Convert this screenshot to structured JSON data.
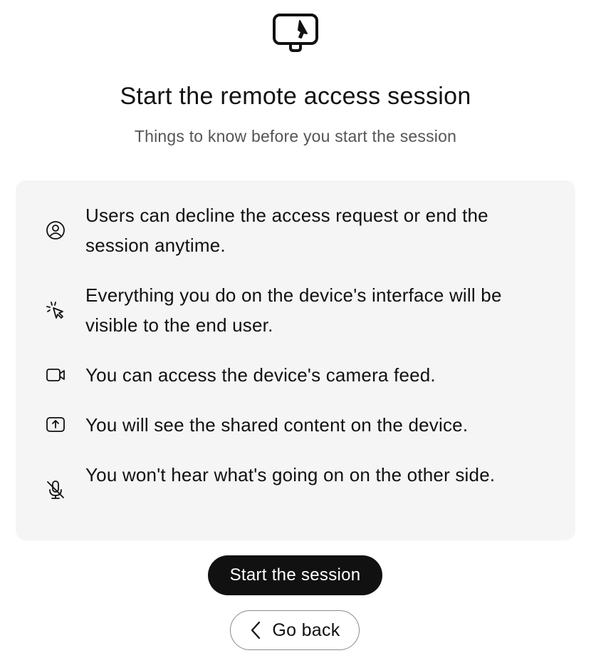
{
  "header": {
    "icon": "monitor-cursor-icon",
    "title": "Start the remote access session",
    "subtitle": "Things to know before you start the session"
  },
  "info": {
    "items": [
      {
        "icon": "user-circle-icon",
        "text": "Users can decline the access request or end the session anytime."
      },
      {
        "icon": "cursor-click-icon",
        "text": "Everything you do on the device's interface will be visible to the end user."
      },
      {
        "icon": "camera-icon",
        "text": "You can access the device's camera feed."
      },
      {
        "icon": "share-screen-icon",
        "text": "You will see the shared content on the device."
      },
      {
        "icon": "microphone-muted-icon",
        "text": "You won't hear what's going on on the other side."
      }
    ]
  },
  "actions": {
    "start_label": "Start the session",
    "back_label": "Go back",
    "back_icon": "chevron-left-icon"
  },
  "colors": {
    "primary_button": "#111111",
    "card_background": "#f5f5f5",
    "subtitle_text": "#555555"
  }
}
